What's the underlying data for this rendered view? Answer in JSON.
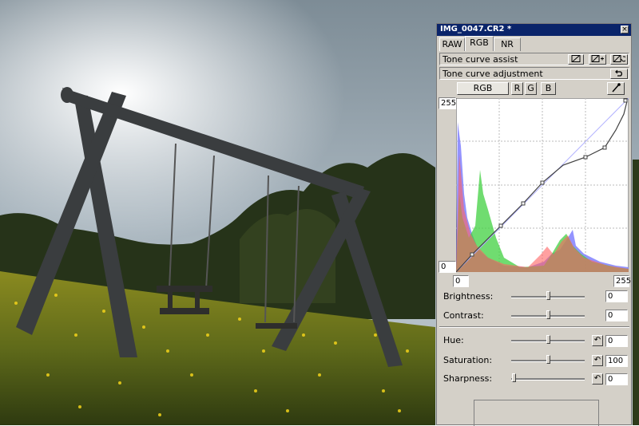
{
  "window": {
    "title": "IMG_0047.CR2 *",
    "close_symbol": "×"
  },
  "tabs": [
    {
      "label": "RAW"
    },
    {
      "label": "RGB"
    },
    {
      "label": "NR"
    }
  ],
  "active_tab": "RGB",
  "tone_curve_assist": {
    "label": "Tone curve assist",
    "buttons": [
      "auto-curve-icon",
      "auto-curve-plus-icon",
      "reset-curve-icon"
    ]
  },
  "tone_curve_adjustment": {
    "label": "Tone curve adjustment",
    "reset_icon": "undo-icon"
  },
  "channel_buttons": {
    "rgb": "RGB",
    "r": "R",
    "g": "G",
    "b": "B"
  },
  "histogram": {
    "input_max": "255",
    "input_min": "0",
    "output_min": "0",
    "output_max": "255",
    "colors": {
      "red": "#ff6060",
      "green": "#40d040",
      "blue": "#6060ff"
    }
  },
  "adjustments": {
    "brightness": {
      "label": "Brightness:",
      "value": "0",
      "level": 0.5
    },
    "contrast": {
      "label": "Contrast:",
      "value": "0",
      "level": 0.5
    },
    "hue": {
      "label": "Hue:",
      "value": "0",
      "level": 0.5
    },
    "saturation": {
      "label": "Saturation:",
      "value": "100",
      "level": 0.5
    },
    "sharpness": {
      "label": "Sharpness:",
      "value": "0",
      "level": 0.0
    }
  }
}
